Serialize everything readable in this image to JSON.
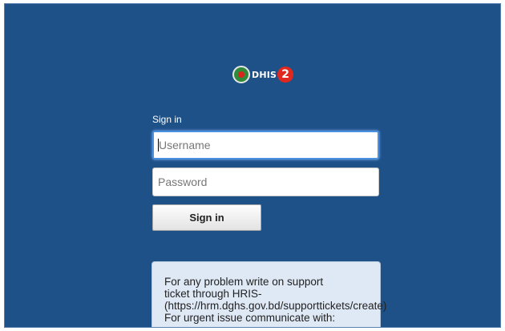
{
  "logo": {
    "text": "DHIS",
    "version": "2"
  },
  "login": {
    "title": "Sign in",
    "username_placeholder": "Username",
    "password_placeholder": "Password",
    "submit_label": "Sign in"
  },
  "notice": {
    "lines": [
      "For any problem write on support",
      "ticket through HRIS-",
      "(https://hrm.dghs.gov.bd/supporttickets/create)",
      "For urgent issue communicate with:"
    ]
  },
  "colors": {
    "background": "#1f5189",
    "notice_background": "#dfe9f6",
    "focus_ring": "#4a90e2"
  }
}
